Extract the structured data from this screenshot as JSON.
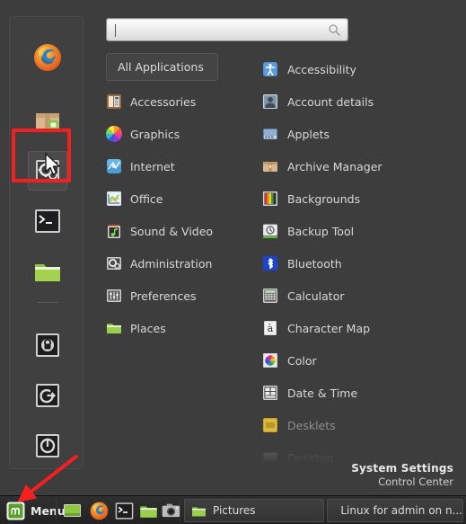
{
  "menu": {
    "search": {
      "value": "",
      "placeholder": "",
      "icon": "search-icon"
    },
    "categories_header": {
      "label": "All Applications"
    },
    "categories": [
      {
        "label": "Accessories",
        "icon": "accessories-icon"
      },
      {
        "label": "Graphics",
        "icon": "graphics-icon"
      },
      {
        "label": "Internet",
        "icon": "internet-icon"
      },
      {
        "label": "Office",
        "icon": "office-icon"
      },
      {
        "label": "Sound & Video",
        "icon": "sound-video-icon"
      },
      {
        "label": "Administration",
        "icon": "administration-icon"
      },
      {
        "label": "Preferences",
        "icon": "preferences-icon"
      },
      {
        "label": "Places",
        "icon": "places-folder-icon"
      }
    ],
    "applications": [
      {
        "label": "Accessibility",
        "icon": "accessibility-icon"
      },
      {
        "label": "Account details",
        "icon": "account-details-icon"
      },
      {
        "label": "Applets",
        "icon": "applets-icon"
      },
      {
        "label": "Archive Manager",
        "icon": "archive-manager-icon"
      },
      {
        "label": "Backgrounds",
        "icon": "backgrounds-icon"
      },
      {
        "label": "Backup Tool",
        "icon": "backup-tool-icon"
      },
      {
        "label": "Bluetooth",
        "icon": "bluetooth-icon"
      },
      {
        "label": "Calculator",
        "icon": "calculator-icon"
      },
      {
        "label": "Character Map",
        "icon": "character-map-icon"
      },
      {
        "label": "Color",
        "icon": "color-icon"
      },
      {
        "label": "Date & Time",
        "icon": "date-time-icon"
      },
      {
        "label": "Desklets",
        "icon": "desklets-icon"
      },
      {
        "label": "Desktop",
        "icon": "desktop-icon"
      }
    ],
    "favorites": [
      {
        "name": "firefox-web-browser",
        "selected": false
      },
      {
        "name": "software-manager",
        "selected": false
      },
      {
        "name": "system-settings",
        "selected": true
      },
      {
        "name": "terminal",
        "selected": false
      },
      {
        "name": "files",
        "selected": false
      },
      {
        "name": "lock-screen",
        "selected": false
      },
      {
        "name": "logout",
        "selected": false
      },
      {
        "name": "quit",
        "selected": false
      }
    ],
    "selection_info": {
      "title": "System Settings",
      "subtitle": "Control Center"
    }
  },
  "taskbar": {
    "menu_button": {
      "label": "Menu",
      "icon": "linux-mint-logo-icon"
    },
    "launchers": [
      {
        "name": "show-desktop-icon"
      },
      {
        "name": "firefox-icon"
      },
      {
        "name": "terminal-icon"
      },
      {
        "name": "files-icon"
      },
      {
        "name": "screenshot-icon"
      }
    ],
    "windows": [
      {
        "label": "Pictures",
        "icon": "folder-icon"
      },
      {
        "label": "Linux for admin on n...",
        "icon": "folder-icon"
      }
    ]
  },
  "annotations": {
    "highlight_color": "#f42020",
    "arrow_color": "#f42020",
    "highlight_target": "system-settings-favorite",
    "arrow_target": "menu-button"
  }
}
